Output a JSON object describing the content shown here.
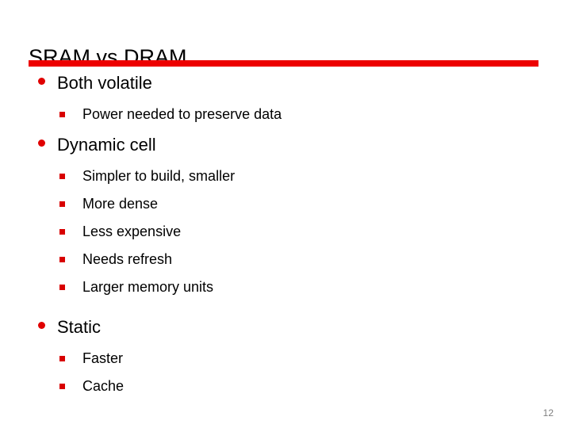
{
  "slide": {
    "title": "SRAM vs DRAM",
    "accent_color": "#ED0000",
    "bullet_round_color": "#E00000",
    "bullet_square_color": "#D80000",
    "background_color": "#FFFFFF",
    "text_color": "#000000",
    "page_number": "12",
    "page_number_color": "#7F7F7F",
    "outline": [
      {
        "level": 1,
        "marker": "round-bullet",
        "text": "Both volatile"
      },
      {
        "level": 2,
        "marker": "square-bullet",
        "text": "Power needed to preserve data"
      },
      {
        "level": 1,
        "marker": "round-bullet",
        "text": "Dynamic cell"
      },
      {
        "level": 2,
        "marker": "square-bullet",
        "text": "Simpler to build, smaller"
      },
      {
        "level": 2,
        "marker": "square-bullet",
        "text": "More dense"
      },
      {
        "level": 2,
        "marker": "square-bullet",
        "text": "Less expensive"
      },
      {
        "level": 2,
        "marker": "square-bullet",
        "text": "Needs refresh"
      },
      {
        "level": 2,
        "marker": "square-bullet",
        "text": "Larger memory units"
      },
      {
        "level": 1,
        "marker": "round-bullet",
        "text": "Static"
      },
      {
        "level": 2,
        "marker": "square-bullet",
        "text": "Faster"
      },
      {
        "level": 2,
        "marker": "square-bullet",
        "text": "Cache"
      }
    ]
  }
}
